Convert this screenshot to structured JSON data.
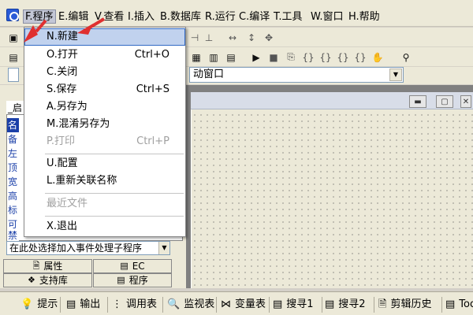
{
  "menubar": {
    "items": [
      {
        "label": "F.程序"
      },
      {
        "label": "E.编辑"
      },
      {
        "label": "V.查看"
      },
      {
        "label": "I.插入"
      },
      {
        "label": "B.数据库"
      },
      {
        "label": "R.运行"
      },
      {
        "label": "C.编译"
      },
      {
        "label": "T.工具"
      },
      {
        "label": "W.窗口"
      },
      {
        "label": "H.帮助"
      }
    ]
  },
  "file_menu": {
    "items": [
      {
        "label": "N.新建",
        "shortcut": ""
      },
      {
        "label": "O.打开",
        "shortcut": "Ctrl+O"
      },
      {
        "label": "C.关闭",
        "shortcut": ""
      },
      {
        "label": "S.保存",
        "shortcut": "Ctrl+S"
      },
      {
        "label": "A.另存为",
        "shortcut": ""
      },
      {
        "label": "M.混淆另存为",
        "shortcut": ""
      },
      {
        "label": "P.打印",
        "shortcut": "Ctrl+P"
      },
      {
        "label": "U.配置",
        "shortcut": ""
      },
      {
        "label": "L.重新关联名称",
        "shortcut": ""
      },
      {
        "label": "最近文件",
        "shortcut": ""
      },
      {
        "label": "X.退出",
        "shortcut": ""
      }
    ]
  },
  "window_combo": {
    "value": "动窗口"
  },
  "property_panel": {
    "header": "_启",
    "rows": [
      "名",
      "备",
      "左",
      "顶",
      "宽",
      "高",
      "标",
      "可",
      "禁"
    ],
    "event_combo": "在此处选择加入事件处理子程序"
  },
  "panel_tabs": {
    "properties": "属性",
    "ec": "EC",
    "support_lib": "支持库",
    "program": "程序"
  },
  "statusbar": {
    "tabs": [
      {
        "label": "提示"
      },
      {
        "label": "输出"
      },
      {
        "label": "调用表"
      },
      {
        "label": "监视表"
      },
      {
        "label": "变量表"
      },
      {
        "label": "搜寻1"
      },
      {
        "label": "搜寻2"
      },
      {
        "label": "剪辑历史"
      },
      {
        "label": "Too"
      }
    ]
  },
  "colors": {
    "menu_highlight": "#c1d2ee",
    "property_selected": "#1a3fa8",
    "annotation_arrow": "#e03030"
  }
}
